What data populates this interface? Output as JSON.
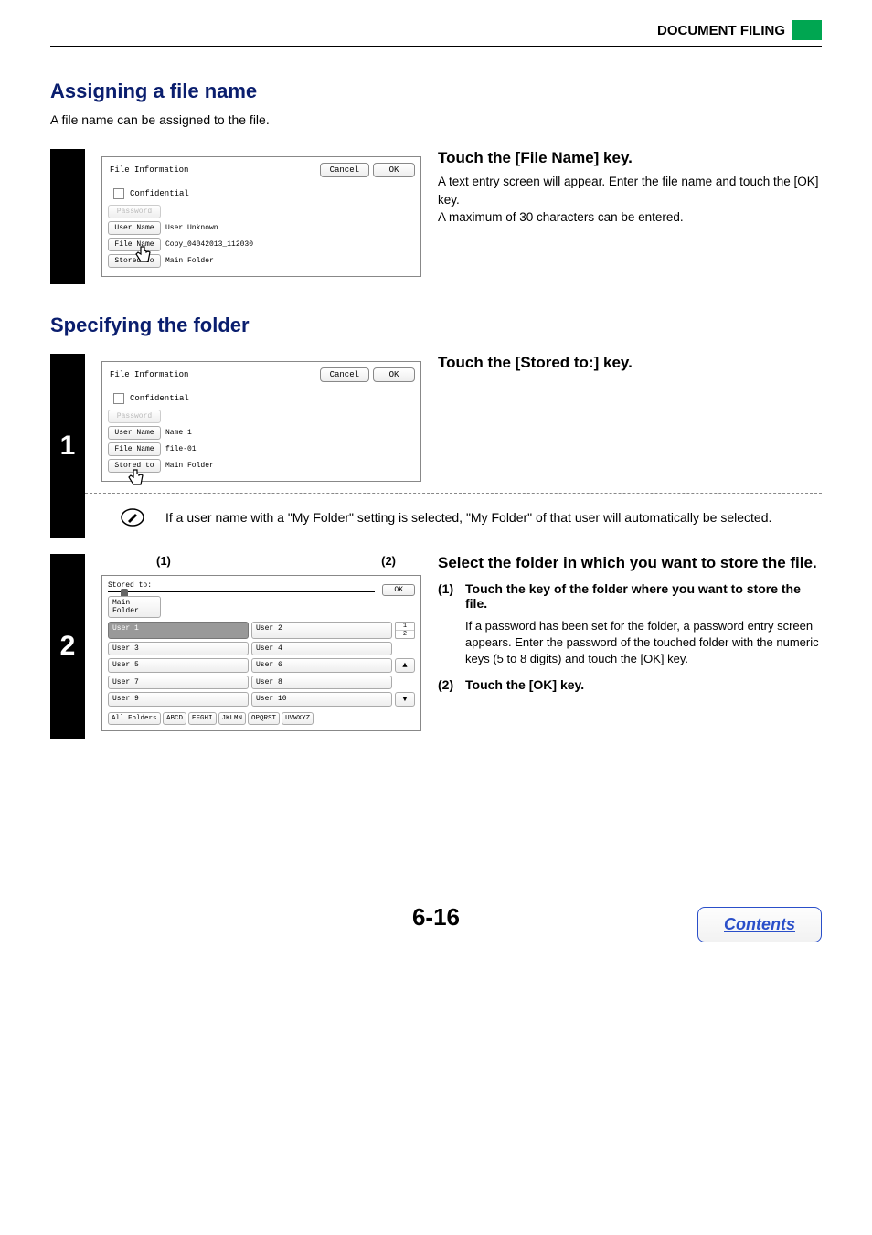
{
  "header": {
    "title": "DOCUMENT FILING"
  },
  "section1": {
    "heading": "Assigning a file name",
    "intro": "A file name can be assigned to the file.",
    "panel": {
      "title": "File Information",
      "cancel": "Cancel",
      "ok": "OK",
      "confidential": "Confidential",
      "password": "Password",
      "username_label": "User Name",
      "username_value": "User Unknown",
      "filename_label": "File Name",
      "filename_value": "Copy_04042013_112030",
      "storedto_label": "Stored to",
      "storedto_value": "Main Folder"
    },
    "step_title": "Touch the [File Name] key.",
    "step_body1": "A text entry screen will appear. Enter the file name and touch the [OK] key.",
    "step_body2": "A maximum of 30 characters can be entered."
  },
  "section2": {
    "heading": "Specifying the folder",
    "step1": {
      "number": "1",
      "panel": {
        "title": "File Information",
        "cancel": "Cancel",
        "ok": "OK",
        "confidential": "Confidential",
        "password": "Password",
        "username_label": "User Name",
        "username_value": "Name 1",
        "filename_label": "File Name",
        "filename_value": "file-01",
        "storedto_label": "Stored to",
        "storedto_value": "Main Folder"
      },
      "title": "Touch the [Stored to:] key.",
      "note": "If a user name with a \"My Folder\" setting is selected, \"My Folder\" of that user will automatically be selected."
    },
    "step2": {
      "number": "2",
      "callouts": {
        "left": "(1)",
        "right": "(2)"
      },
      "panel": {
        "title": "Stored to:",
        "ok": "OK",
        "main_folder": "Main Folder",
        "users": [
          "User 1",
          "User 2",
          "User 3",
          "User 4",
          "User 5",
          "User 6",
          "User 7",
          "User 8",
          "User 9",
          "User 10"
        ],
        "page_top": "1",
        "page_cur": "2",
        "alpha": [
          "All Folders",
          "ABCD",
          "EFGHI",
          "JKLMN",
          "OPQRST",
          "UVWXYZ"
        ]
      },
      "title": "Select the folder in which you want to store the file.",
      "sub1_num": "(1)",
      "sub1_title": "Touch the key of the folder where you want to store the file.",
      "sub1_text": "If a password has been set for the folder, a password entry screen appears. Enter the password of the touched folder with the numeric keys (5 to 8 digits) and touch the [OK] key.",
      "sub2_num": "(2)",
      "sub2_title": "Touch the [OK] key."
    }
  },
  "page_number": "6-16",
  "contents": "Contents"
}
